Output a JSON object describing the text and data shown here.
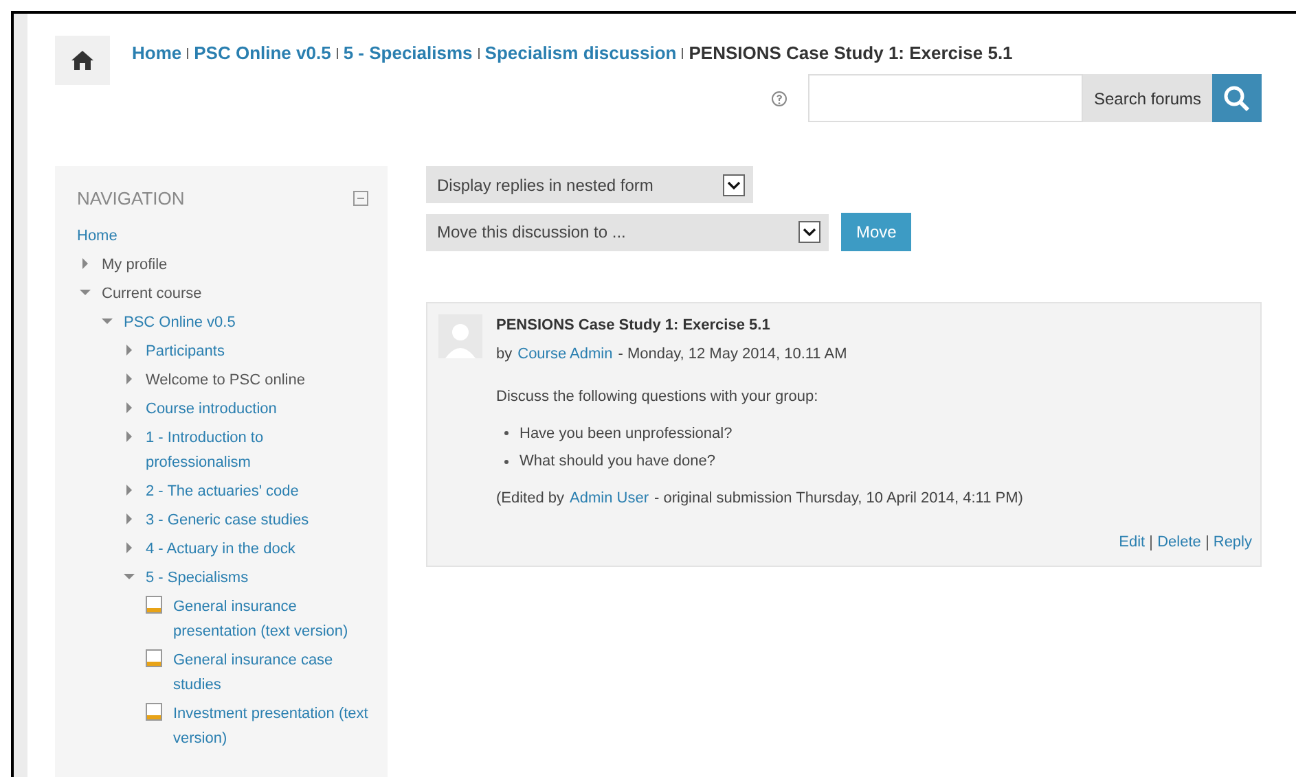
{
  "breadcrumb": [
    {
      "label": "Home",
      "link": true
    },
    {
      "label": "PSC Online v0.5",
      "link": true
    },
    {
      "label": "5 - Specialisms",
      "link": true
    },
    {
      "label": "Specialism discussion",
      "link": true
    },
    {
      "label": "PENSIONS Case Study 1: Exercise 5.1",
      "link": false
    }
  ],
  "search": {
    "button": "Search forums"
  },
  "navigation": {
    "title": "NAVIGATION",
    "items": [
      {
        "kind": "home",
        "label": "Home",
        "link": true
      },
      {
        "kind": "branch",
        "label": "My profile",
        "link": false,
        "expanded": false
      },
      {
        "kind": "branch",
        "label": "Current course",
        "link": false,
        "expanded": true,
        "children": [
          {
            "kind": "branch",
            "label": "PSC Online v0.5",
            "link": true,
            "expanded": true,
            "children": [
              {
                "kind": "branch",
                "label": "Participants",
                "link": true,
                "expanded": false
              },
              {
                "kind": "branch",
                "label": "Welcome to PSC online",
                "link": false,
                "expanded": false
              },
              {
                "kind": "branch",
                "label": "Course introduction",
                "link": true,
                "expanded": false
              },
              {
                "kind": "branch",
                "label": "1 - Introduction to professionalism",
                "link": true,
                "expanded": false
              },
              {
                "kind": "branch",
                "label": "2 - The actuaries' code",
                "link": true,
                "expanded": false
              },
              {
                "kind": "branch",
                "label": "3 - Generic case studies",
                "link": true,
                "expanded": false
              },
              {
                "kind": "branch",
                "label": "4 - Actuary in the dock",
                "link": true,
                "expanded": false
              },
              {
                "kind": "branch",
                "label": "5 - Specialisms",
                "link": true,
                "expanded": true,
                "children": [
                  {
                    "kind": "page",
                    "label": "General insurance presentation (text version)",
                    "link": true
                  },
                  {
                    "kind": "page",
                    "label": "General insurance case studies",
                    "link": true
                  },
                  {
                    "kind": "page",
                    "label": "Investment presentation (text version)",
                    "link": true
                  }
                ]
              }
            ]
          }
        ]
      }
    ]
  },
  "display_mode": {
    "value": "Display replies in nested form"
  },
  "move": {
    "value": "Move this discussion to ...",
    "button": "Move"
  },
  "post": {
    "subject": "PENSIONS Case Study 1: Exercise 5.1",
    "by": "by",
    "author": "Course Admin",
    "date": "- Monday, 12 May 2014, 10.11 AM",
    "intro": "Discuss the following questions with your group:",
    "bullets": [
      "Have you been unprofessional?",
      "What should you have done?"
    ],
    "edited": {
      "before": "(Edited by",
      "user": "Admin User",
      "after": "- original submission Thursday, 10 April 2014, 4:11 PM)"
    },
    "actions": [
      "Edit",
      "Delete",
      "Reply"
    ]
  }
}
